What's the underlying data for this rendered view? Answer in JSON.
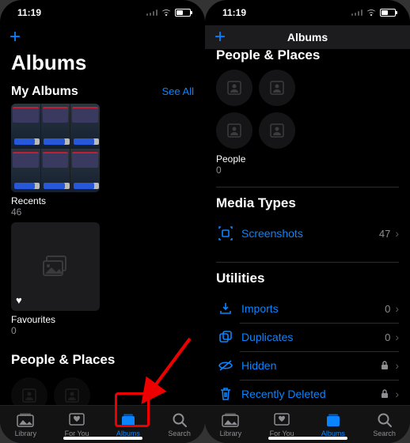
{
  "status": {
    "time": "11:19"
  },
  "left": {
    "header": {
      "large_title": "Albums"
    },
    "my_albums": {
      "title": "My Albums",
      "see_all": "See All",
      "recents": {
        "label": "Recents",
        "count": "46"
      },
      "favourites": {
        "label": "Favourites",
        "count": "0"
      }
    },
    "people_places_title": "People & Places"
  },
  "right": {
    "nav_title": "Albums",
    "cutoff_title": "People & Places",
    "people": {
      "label": "People",
      "count": "0"
    },
    "media_types": {
      "title": "Media Types",
      "screenshots": {
        "label": "Screenshots",
        "count": "47"
      }
    },
    "utilities": {
      "title": "Utilities",
      "imports": {
        "label": "Imports",
        "count": "0"
      },
      "duplicates": {
        "label": "Duplicates",
        "count": "0"
      },
      "hidden": {
        "label": "Hidden"
      },
      "recently_deleted": {
        "label": "Recently Deleted"
      }
    }
  },
  "tabs": {
    "library": "Library",
    "for_you": "For You",
    "albums": "Albums",
    "search": "Search"
  }
}
